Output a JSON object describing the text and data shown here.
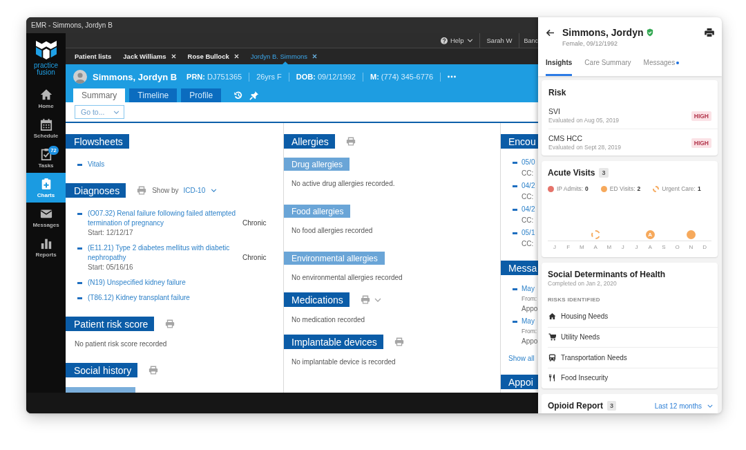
{
  "window": {
    "title": "EMR - Simmons, Jordyn B"
  },
  "logo": {
    "text": "practice fusion"
  },
  "nav": [
    {
      "label": "Home",
      "kind": "home",
      "selected": false
    },
    {
      "label": "Schedule",
      "kind": "schedule",
      "selected": false
    },
    {
      "label": "Tasks",
      "kind": "tasks",
      "selected": false,
      "badge": "72"
    },
    {
      "label": "Charts",
      "kind": "charts",
      "selected": true
    },
    {
      "label": "Messages",
      "kind": "messages",
      "selected": false
    },
    {
      "label": "Reports",
      "kind": "reports",
      "selected": false
    }
  ],
  "top_bar": {
    "help": "Help",
    "user": "Sarah W",
    "account": "Banc"
  },
  "patient_tabs": [
    {
      "label": "Patient lists",
      "closable": false,
      "selected": false
    },
    {
      "label": "Jack Williams",
      "closable": true,
      "selected": false
    },
    {
      "label": "Rose Bullock",
      "closable": true,
      "selected": false
    },
    {
      "label": "Jordyn B. Simmons",
      "closable": true,
      "selected": true
    }
  ],
  "patient": {
    "name": "Simmons, Jordyn B",
    "fields": [
      {
        "label": "PRN:",
        "value": "DJ751365"
      },
      {
        "value": "26yrs F"
      },
      {
        "label": "DOB:",
        "value": "09/12/1992"
      },
      {
        "label": "M:",
        "value": "(774) 345-6776"
      }
    ]
  },
  "chart_tabs": [
    {
      "label": "Summary",
      "selected": true
    },
    {
      "label": "Timeline",
      "selected": false
    },
    {
      "label": "Profile",
      "selected": false
    }
  ],
  "goto": {
    "placeholder": "Go to..."
  },
  "columns": [
    {
      "sections": [
        {
          "title": "Flowsheets",
          "items": [
            {
              "text": "Vitals"
            }
          ]
        },
        {
          "title": "Diagnoses",
          "printable": true,
          "show_by": {
            "label": "Show by",
            "value": "ICD-10"
          },
          "items": [
            {
              "text": "(O07.32) Renal failure following failed attempted termination of pregnancy",
              "status": "Chronic",
              "start": "Start: 12/12/17"
            },
            {
              "text": "(E11.21) Type 2 diabetes mellitus with diabetic nephropathy",
              "status": "Chronic",
              "start": "Start: 05/16/16"
            },
            {
              "text": "(N19) Unspecified kidney failure"
            },
            {
              "text": "(T86.12) Kidney transplant failure"
            }
          ]
        },
        {
          "title": "Patient risk score",
          "printable": true,
          "empty_text": "No patient risk score recorded"
        },
        {
          "title": "Social history",
          "printable": true,
          "more_below": true
        }
      ]
    },
    {
      "sections": [
        {
          "title": "Allergies",
          "printable": true,
          "subsections": [
            {
              "title": "Drug allergies",
              "empty_text": "No active drug allergies recorded."
            },
            {
              "title": "Food allergies",
              "empty_text": "No food allergies recorded"
            },
            {
              "title": "Environmental allergies",
              "empty_text": "No environmental allergies recorded"
            }
          ]
        },
        {
          "title": "Medications",
          "printable": true,
          "expandable": true,
          "empty_text": "No medication recorded"
        },
        {
          "title": "Implantable devices",
          "printable": true,
          "empty_text": "No implantable device is recorded"
        }
      ]
    },
    {
      "sections": [
        {
          "title": "Encou",
          "items": [
            {
              "text": "05/0",
              "detail": "CC:"
            },
            {
              "text": "04/2",
              "detail": "CC:"
            },
            {
              "text": "04/2",
              "detail": "CC:"
            },
            {
              "text": "05/1",
              "detail": "CC:"
            }
          ]
        },
        {
          "title": "Messa",
          "items": [
            {
              "text": "May",
              "from": "From:",
              "detail": "Appo"
            },
            {
              "text": "May",
              "from": "From:",
              "detail": "Appo"
            }
          ],
          "link": "Show all"
        },
        {
          "title": "Appoi"
        }
      ]
    }
  ],
  "panel": {
    "name": "Simmons, Jordyn",
    "verified": true,
    "subtitle": "Female, 09/12/1992",
    "tabs": [
      {
        "label": "Insights",
        "selected": true,
        "unread": false
      },
      {
        "label": "Care Summary",
        "selected": false,
        "unread": false
      },
      {
        "label": "Messages",
        "selected": false,
        "unread": true
      }
    ],
    "risk": {
      "title": "Risk",
      "items": [
        {
          "name": "SVI",
          "evaluated": "Evaluated on Aug 05, 2019",
          "rating": "HIGH"
        },
        {
          "name": "CMS HCC",
          "evaluated": "Evaluated on Sept 28, 2019",
          "rating": "HIGH"
        }
      ]
    },
    "acute_visits": {
      "title": "Acute Visits",
      "count": "3",
      "legend": [
        {
          "kind": "ip_admit",
          "label": "IP Admits:",
          "count": "0",
          "color": "#e5736a"
        },
        {
          "kind": "ed_visit",
          "label": "ED Visits:",
          "count": "2",
          "color": "#f6a95c"
        },
        {
          "kind": "urgent_care",
          "label": "Urgent Care:",
          "count": "1",
          "color": "#f6a95c"
        }
      ],
      "timeline": [
        {
          "month": "J",
          "kind": "empty"
        },
        {
          "month": "F",
          "kind": "empty"
        },
        {
          "month": "M",
          "kind": "empty"
        },
        {
          "month": "A",
          "kind": "urgent_care"
        },
        {
          "month": "M",
          "kind": "empty"
        },
        {
          "month": "J",
          "kind": "empty"
        },
        {
          "month": "J",
          "kind": "empty"
        },
        {
          "month": "A",
          "kind": "ed_visit",
          "marker": "A"
        },
        {
          "month": "S",
          "kind": "empty"
        },
        {
          "month": "O",
          "kind": "empty"
        },
        {
          "month": "N",
          "kind": "ed_visit"
        },
        {
          "month": "D",
          "kind": "empty"
        }
      ]
    },
    "sdoh": {
      "title": "Social Determinants of Health",
      "completed": "Completed on Jan 2, 2020",
      "heading": "RISKS IDENTIFIED",
      "risks": [
        {
          "kind": "housing",
          "label": "Housing Needs"
        },
        {
          "kind": "utility",
          "label": "Utility Needs"
        },
        {
          "kind": "transportation",
          "label": "Transportation Needs"
        },
        {
          "kind": "food",
          "label": "Food Insecurity"
        }
      ]
    },
    "opioid": {
      "title": "Opioid Report",
      "count": "3",
      "period": "Last 12 months"
    }
  }
}
